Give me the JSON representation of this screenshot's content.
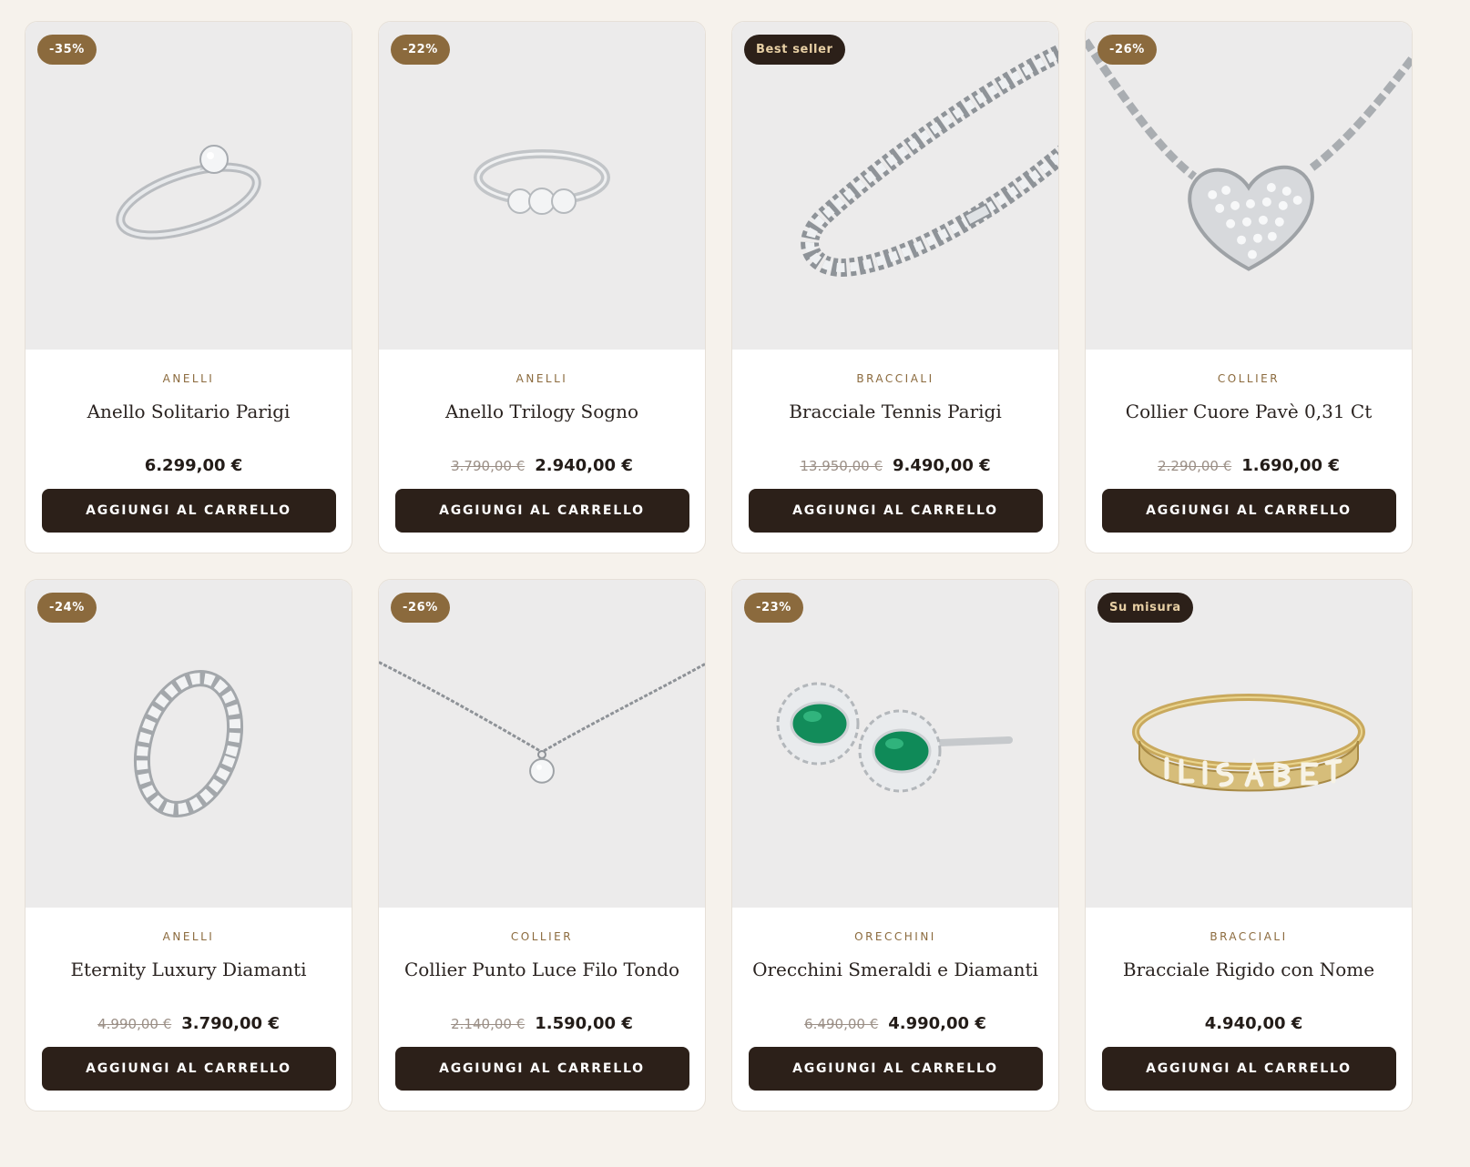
{
  "colors": {
    "page_bg": "#f6f2ec",
    "image_bg": "#ecebeb",
    "accent_gold": "#8b6a3d",
    "dark_button": "#2c2019",
    "badge_dark_text": "#e7cfa4"
  },
  "button_label": "AGGIUNGI AL CARRELLO",
  "products": [
    {
      "badge": "-35%",
      "badge_style": "discount",
      "image_icon": "solitaire-ring-icon",
      "category": "ANELLI",
      "name": "Anello Solitario Parigi",
      "old_price": "",
      "price": "6.299,00 €"
    },
    {
      "badge": "-22%",
      "badge_style": "discount",
      "image_icon": "trilogy-ring-icon",
      "category": "ANELLI",
      "name": "Anello Trilogy Sogno",
      "old_price": "3.790,00 €",
      "price": "2.940,00 €"
    },
    {
      "badge": "Best seller",
      "badge_style": "dark",
      "image_icon": "tennis-bracelet-icon",
      "category": "BRACCIALI",
      "name": "Bracciale Tennis Parigi",
      "old_price": "13.950,00 €",
      "price": "9.490,00 €"
    },
    {
      "badge": "-26%",
      "badge_style": "discount",
      "image_icon": "heart-necklace-icon",
      "category": "COLLIER",
      "name": "Collier Cuore Pavè 0,31 Ct",
      "old_price": "2.290,00 €",
      "price": "1.690,00 €"
    },
    {
      "badge": "-24%",
      "badge_style": "discount",
      "image_icon": "eternity-ring-icon",
      "category": "ANELLI",
      "name": "Eternity Luxury Diamanti",
      "old_price": "4.990,00 €",
      "price": "3.790,00 €"
    },
    {
      "badge": "-26%",
      "badge_style": "discount",
      "image_icon": "solitaire-necklace-icon",
      "category": "COLLIER",
      "name": "Collier Punto Luce Filo Tondo",
      "old_price": "2.140,00 €",
      "price": "1.590,00 €"
    },
    {
      "badge": "-23%",
      "badge_style": "discount",
      "image_icon": "emerald-earrings-icon",
      "category": "ORECCHINI",
      "name": "Orecchini Smeraldi e Diamanti",
      "old_price": "6.490,00 €",
      "price": "4.990,00 €"
    },
    {
      "badge": "Su misura",
      "badge_style": "dark",
      "image_icon": "name-bangle-icon",
      "category": "BRACCIALI",
      "name": "Bracciale Rigido con Nome",
      "old_price": "",
      "price": "4.940,00 €"
    }
  ]
}
